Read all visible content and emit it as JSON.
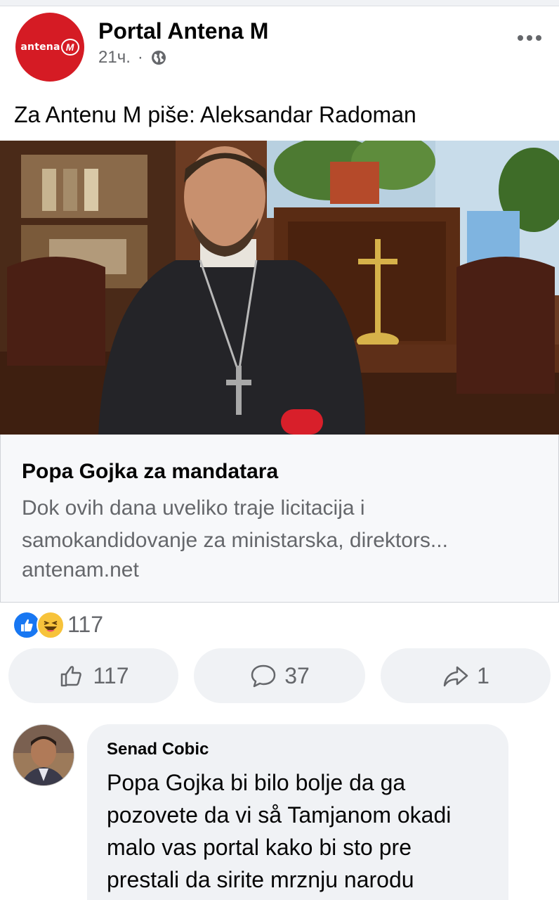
{
  "post": {
    "page_name": "Portal Antena M",
    "logo_text": "antena",
    "logo_badge": "M",
    "time": "21ч.",
    "separator": "·",
    "privacy_icon": "globe-icon",
    "text": "Za Antenu M piše: Aleksandar Radoman"
  },
  "link": {
    "title": "Popa Gojka za mandatara",
    "description": "Dok ovih dana uveliko traje licitacija i samokandidovanje za ministarska, direktors...",
    "domain": "antenam.net"
  },
  "reactions": {
    "icons": [
      "like-reaction-icon",
      "haha-reaction-icon"
    ],
    "count": "117"
  },
  "actions": {
    "likes": "117",
    "comments": "37",
    "shares": "1"
  },
  "comment": {
    "author": "Senad Cobic",
    "text": "Popa Gojka bi bilo bolje da ga\npozovete da vi så Tamjanom okadi\nmalo vas portal kako bi  sto pre\nprestali da sirite mrznju narodu"
  },
  "colors": {
    "brand_red": "#d51b24",
    "fb_blue": "#1877f2",
    "secondary_text": "#65676b",
    "button_bg": "#f0f2f5"
  }
}
